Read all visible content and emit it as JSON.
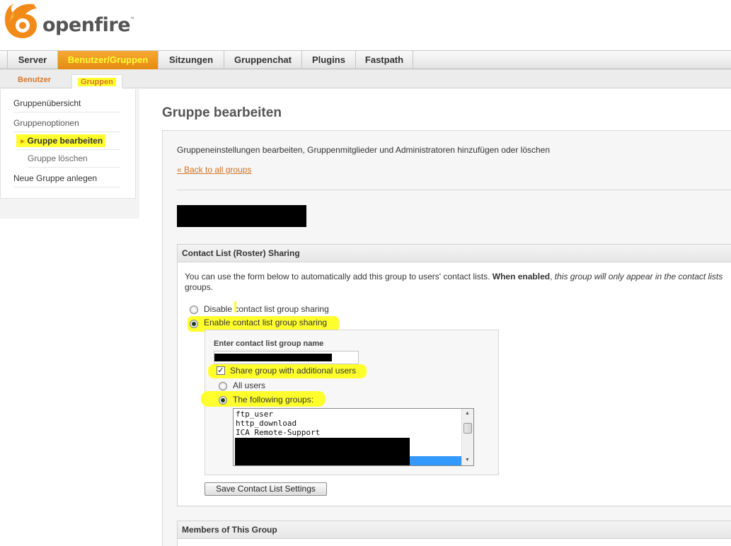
{
  "app": {
    "logo_text": "openfire",
    "logo_tm": "™"
  },
  "main_nav": {
    "tabs": [
      {
        "label": "Server"
      },
      {
        "label": "Benutzer/Gruppen",
        "active": true
      },
      {
        "label": "Sitzungen"
      },
      {
        "label": "Gruppenchat"
      },
      {
        "label": "Plugins"
      },
      {
        "label": "Fastpath"
      }
    ]
  },
  "sub_nav": {
    "tabs": [
      {
        "label": "Benutzer"
      },
      {
        "label": "Gruppen",
        "active": true
      }
    ]
  },
  "sidebar": {
    "items": [
      {
        "label": "Gruppenübersicht"
      },
      {
        "label": "Gruppenoptionen"
      },
      {
        "label": "Gruppe bearbeiten",
        "active": true
      },
      {
        "label": "Gruppe löschen"
      },
      {
        "label": "Neue Gruppe anlegen"
      }
    ]
  },
  "main": {
    "title": "Gruppe bearbeiten",
    "intro": "Gruppeneinstellungen bearbeiten, Gruppenmitglieder und Administratoren hinzufügen oder löschen",
    "back_link": "« Back to all groups"
  },
  "sharing": {
    "header": "Contact List (Roster) Sharing",
    "desc_part1": "You can use the form below to automatically add this group to users' contact lists. ",
    "desc_bold": "When enabled",
    "desc_part2": ", ",
    "desc_italic": "this group will only appear in the contact lists",
    "desc_line2": "groups.",
    "disable_label": "Disable contact list group sharing",
    "enable_label": "Enable contact list group sharing",
    "sharing_enabled": true,
    "group_name_label": "Enter contact list group name",
    "share_additional_label": "Share group with additional users",
    "share_additional_checked": true,
    "all_users_label": "All users",
    "following_groups_label": "The following groups:",
    "following_groups_selected": true,
    "groups_list": [
      "ftp_user",
      "http_download",
      "ICA Remote-Support"
    ],
    "save_button": "Save Contact List Settings"
  },
  "members": {
    "header": "Members of This Group"
  },
  "colors": {
    "accent_orange": "#e48a10",
    "link_orange": "#d07020",
    "highlight_yellow": "#ffff2e",
    "selection_blue": "#3399ff"
  }
}
